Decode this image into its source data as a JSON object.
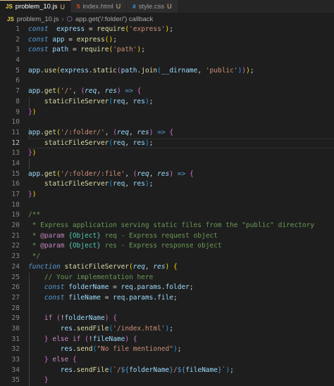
{
  "tabs": [
    {
      "label": "problem_10.js",
      "status": "U",
      "icon": "JS",
      "icon_color": "#e8d44d",
      "active": true
    },
    {
      "label": "index.html",
      "status": "U",
      "icon": "5",
      "icon_color": "#e44d26",
      "active": false
    },
    {
      "label": "style.css",
      "status": "U",
      "icon": "#",
      "icon_color": "#42a5f5",
      "active": false
    }
  ],
  "breadcrumb": {
    "file": "problem_10.js",
    "file_icon": "JS",
    "symbol": "app.get('/:folder/') callback",
    "symbol_icon": "cube-icon"
  },
  "editor": {
    "current_line": 12,
    "line_numbers": [
      "1",
      "2",
      "3",
      "4",
      "5",
      "6",
      "7",
      "8",
      "9",
      "10",
      "11",
      "12",
      "13",
      "14",
      "15",
      "16",
      "17",
      "18",
      "19",
      "20",
      "21",
      "22",
      "23",
      "24",
      "25",
      "26",
      "27",
      "28",
      "29",
      "30",
      "31",
      "32",
      "33",
      "34",
      "35"
    ],
    "lines": [
      [
        [
          "k",
          "const"
        ],
        [
          "",
          "  "
        ],
        [
          "v",
          "express"
        ],
        [
          "",
          " = "
        ],
        [
          "f",
          "require"
        ],
        [
          "b1",
          "("
        ],
        [
          "s",
          "'express'"
        ],
        [
          "b1",
          ")"
        ],
        [
          "",
          ";"
        ]
      ],
      [
        [
          "k",
          "const"
        ],
        [
          "",
          " "
        ],
        [
          "v",
          "app"
        ],
        [
          "",
          " = "
        ],
        [
          "f",
          "express"
        ],
        [
          "b1",
          "()"
        ],
        [
          "",
          ";"
        ]
      ],
      [
        [
          "k",
          "const"
        ],
        [
          "",
          " "
        ],
        [
          "v",
          "path"
        ],
        [
          "",
          " = "
        ],
        [
          "f",
          "require"
        ],
        [
          "b1",
          "("
        ],
        [
          "s",
          "'path'"
        ],
        [
          "b1",
          ")"
        ],
        [
          "",
          ";"
        ]
      ],
      [],
      [
        [
          "v",
          "app"
        ],
        [
          ".",
          ""
        ],
        [
          "f",
          ".use"
        ],
        [
          "b1",
          "("
        ],
        [
          "v",
          "express"
        ],
        [
          "",
          "."
        ],
        [
          "f",
          "static"
        ],
        [
          "b2",
          "("
        ],
        [
          "v",
          "path"
        ],
        [
          "",
          "."
        ],
        [
          "f",
          "join"
        ],
        [
          "b3",
          "("
        ],
        [
          "v",
          "__dirname"
        ],
        [
          "",
          ", "
        ],
        [
          "s",
          "'public'"
        ],
        [
          "b3",
          ")"
        ],
        [
          "b2",
          ")"
        ],
        [
          "b1",
          ")"
        ],
        [
          "",
          ";"
        ]
      ],
      [],
      [
        [
          "v",
          "app"
        ],
        [
          "",
          "."
        ],
        [
          "f",
          "get"
        ],
        [
          "b1",
          "("
        ],
        [
          "s",
          "'/'"
        ],
        [
          "",
          ", "
        ],
        [
          "b2",
          "("
        ],
        [
          "p",
          "req"
        ],
        [
          "",
          ", "
        ],
        [
          "p",
          "res"
        ],
        [
          "b2",
          ")"
        ],
        [
          "",
          " "
        ],
        [
          "k",
          "=>"
        ],
        [
          "",
          " "
        ],
        [
          "b2",
          "{"
        ]
      ],
      [
        [
          "",
          "    "
        ],
        [
          "f",
          "staticFileServer"
        ],
        [
          "b3",
          "("
        ],
        [
          "v",
          "req"
        ],
        [
          "",
          ", "
        ],
        [
          "v",
          "res"
        ],
        [
          "b3",
          ")"
        ],
        [
          "",
          ";"
        ]
      ],
      [
        [
          "b2",
          "}"
        ],
        [
          "b1",
          ")"
        ]
      ],
      [],
      [
        [
          "v",
          "app"
        ],
        [
          "",
          "."
        ],
        [
          "f",
          "get"
        ],
        [
          "b1",
          "("
        ],
        [
          "s",
          "'/:folder/'"
        ],
        [
          "",
          ", "
        ],
        [
          "b2",
          "("
        ],
        [
          "p",
          "req"
        ],
        [
          "",
          ", "
        ],
        [
          "p",
          "res"
        ],
        [
          "b2",
          ")"
        ],
        [
          "",
          " "
        ],
        [
          "k",
          "=>"
        ],
        [
          "",
          " "
        ],
        [
          "b2",
          "{"
        ]
      ],
      [
        [
          "",
          "    "
        ],
        [
          "f",
          "staticFileServer"
        ],
        [
          "b3",
          "("
        ],
        [
          "v",
          "req"
        ],
        [
          "",
          ", "
        ],
        [
          "v",
          "res"
        ],
        [
          "b3",
          ")"
        ],
        [
          "",
          ";"
        ]
      ],
      [
        [
          "b2",
          "}"
        ],
        [
          "b1",
          ")"
        ]
      ],
      [],
      [
        [
          "v",
          "app"
        ],
        [
          "",
          "."
        ],
        [
          "f",
          "get"
        ],
        [
          "b1",
          "("
        ],
        [
          "s",
          "'/:folder/:file'"
        ],
        [
          "",
          ", "
        ],
        [
          "b2",
          "("
        ],
        [
          "p",
          "req"
        ],
        [
          "",
          ", "
        ],
        [
          "p",
          "res"
        ],
        [
          "b2",
          ")"
        ],
        [
          "",
          " "
        ],
        [
          "k",
          "=>"
        ],
        [
          "",
          " "
        ],
        [
          "b2",
          "{"
        ]
      ],
      [
        [
          "",
          "    "
        ],
        [
          "f",
          "staticFileServer"
        ],
        [
          "b3",
          "("
        ],
        [
          "v",
          "req"
        ],
        [
          "",
          ", "
        ],
        [
          "v",
          "res"
        ],
        [
          "b3",
          ")"
        ],
        [
          "",
          ";"
        ]
      ],
      [
        [
          "b2",
          "}"
        ],
        [
          "b1",
          ")"
        ]
      ],
      [],
      [
        [
          "c",
          "/**"
        ]
      ],
      [
        [
          "c",
          " * Express application serving static files from the \"public\" directory"
        ]
      ],
      [
        [
          "c",
          " * "
        ],
        [
          "kc",
          "@param"
        ],
        [
          "c",
          " "
        ],
        [
          "cy",
          "{Object}"
        ],
        [
          "c",
          " req - Express request object"
        ]
      ],
      [
        [
          "c",
          " * "
        ],
        [
          "kc",
          "@param"
        ],
        [
          "c",
          " "
        ],
        [
          "cy",
          "{Object}"
        ],
        [
          "c",
          " res - Express response object"
        ]
      ],
      [
        [
          "c",
          " */"
        ]
      ],
      [
        [
          "ct",
          "function"
        ],
        [
          "",
          " "
        ],
        [
          "f",
          "staticFileServer"
        ],
        [
          "b1",
          "("
        ],
        [
          "p",
          "req"
        ],
        [
          "",
          ", "
        ],
        [
          "p",
          "res"
        ],
        [
          "b1",
          ")"
        ],
        [
          "",
          " "
        ],
        [
          "b1",
          "{"
        ]
      ],
      [
        [
          "",
          "    "
        ],
        [
          "c",
          "// Your implementation here"
        ]
      ],
      [
        [
          "",
          "    "
        ],
        [
          "k",
          "const"
        ],
        [
          "",
          " "
        ],
        [
          "v",
          "folderName"
        ],
        [
          "",
          " = "
        ],
        [
          "v",
          "req"
        ],
        [
          "",
          "."
        ],
        [
          "v",
          "params"
        ],
        [
          "",
          "."
        ],
        [
          "v",
          "folder"
        ],
        [
          "",
          ";"
        ]
      ],
      [
        [
          "",
          "    "
        ],
        [
          "k",
          "const"
        ],
        [
          "",
          " "
        ],
        [
          "v",
          "fileName"
        ],
        [
          "",
          " = "
        ],
        [
          "v",
          "req"
        ],
        [
          "",
          "."
        ],
        [
          "v",
          "params"
        ],
        [
          "",
          "."
        ],
        [
          "v",
          "file"
        ],
        [
          "",
          ";"
        ]
      ],
      [],
      [
        [
          "",
          "    "
        ],
        [
          "kc",
          "if"
        ],
        [
          "",
          " "
        ],
        [
          "b2",
          "("
        ],
        [
          "",
          "!"
        ],
        [
          "v",
          "folderName"
        ],
        [
          "b2",
          ")"
        ],
        [
          "",
          " "
        ],
        [
          "b2",
          "{"
        ]
      ],
      [
        [
          "",
          "        "
        ],
        [
          "v",
          "res"
        ],
        [
          "",
          "."
        ],
        [
          "f",
          "sendFile"
        ],
        [
          "b3",
          "("
        ],
        [
          "s",
          "'/index.html'"
        ],
        [
          "b3",
          ")"
        ],
        [
          "",
          ";"
        ]
      ],
      [
        [
          "",
          "    "
        ],
        [
          "b2",
          "}"
        ],
        [
          "",
          " "
        ],
        [
          "kc",
          "else if"
        ],
        [
          "",
          " "
        ],
        [
          "b2",
          "("
        ],
        [
          "",
          "!"
        ],
        [
          "v",
          "fileName"
        ],
        [
          "b2",
          ")"
        ],
        [
          "",
          " "
        ],
        [
          "b2",
          "{"
        ]
      ],
      [
        [
          "",
          "        "
        ],
        [
          "v",
          "res"
        ],
        [
          "",
          "."
        ],
        [
          "f",
          "send"
        ],
        [
          "b3",
          "("
        ],
        [
          "s",
          "\"No file mentioned\""
        ],
        [
          "b3",
          ")"
        ],
        [
          "",
          ";"
        ]
      ],
      [
        [
          "",
          "    "
        ],
        [
          "b2",
          "}"
        ],
        [
          "",
          " "
        ],
        [
          "kc",
          "else"
        ],
        [
          "",
          " "
        ],
        [
          "b2",
          "{"
        ]
      ],
      [
        [
          "",
          "        "
        ],
        [
          "v",
          "res"
        ],
        [
          "",
          "."
        ],
        [
          "f",
          "sendFile"
        ],
        [
          "b3",
          "("
        ],
        [
          "s",
          "`/"
        ],
        [
          "tmp",
          "${"
        ],
        [
          "v",
          "folderName"
        ],
        [
          "tmp",
          "}"
        ],
        [
          "s",
          "/"
        ],
        [
          "tmp",
          "${"
        ],
        [
          "v",
          "fileName"
        ],
        [
          "tmp",
          "}"
        ],
        [
          "s",
          "`"
        ],
        [
          "b3",
          ")"
        ],
        [
          "",
          ";"
        ]
      ],
      [
        [
          "",
          "    "
        ],
        [
          "b2",
          "}"
        ]
      ]
    ]
  }
}
